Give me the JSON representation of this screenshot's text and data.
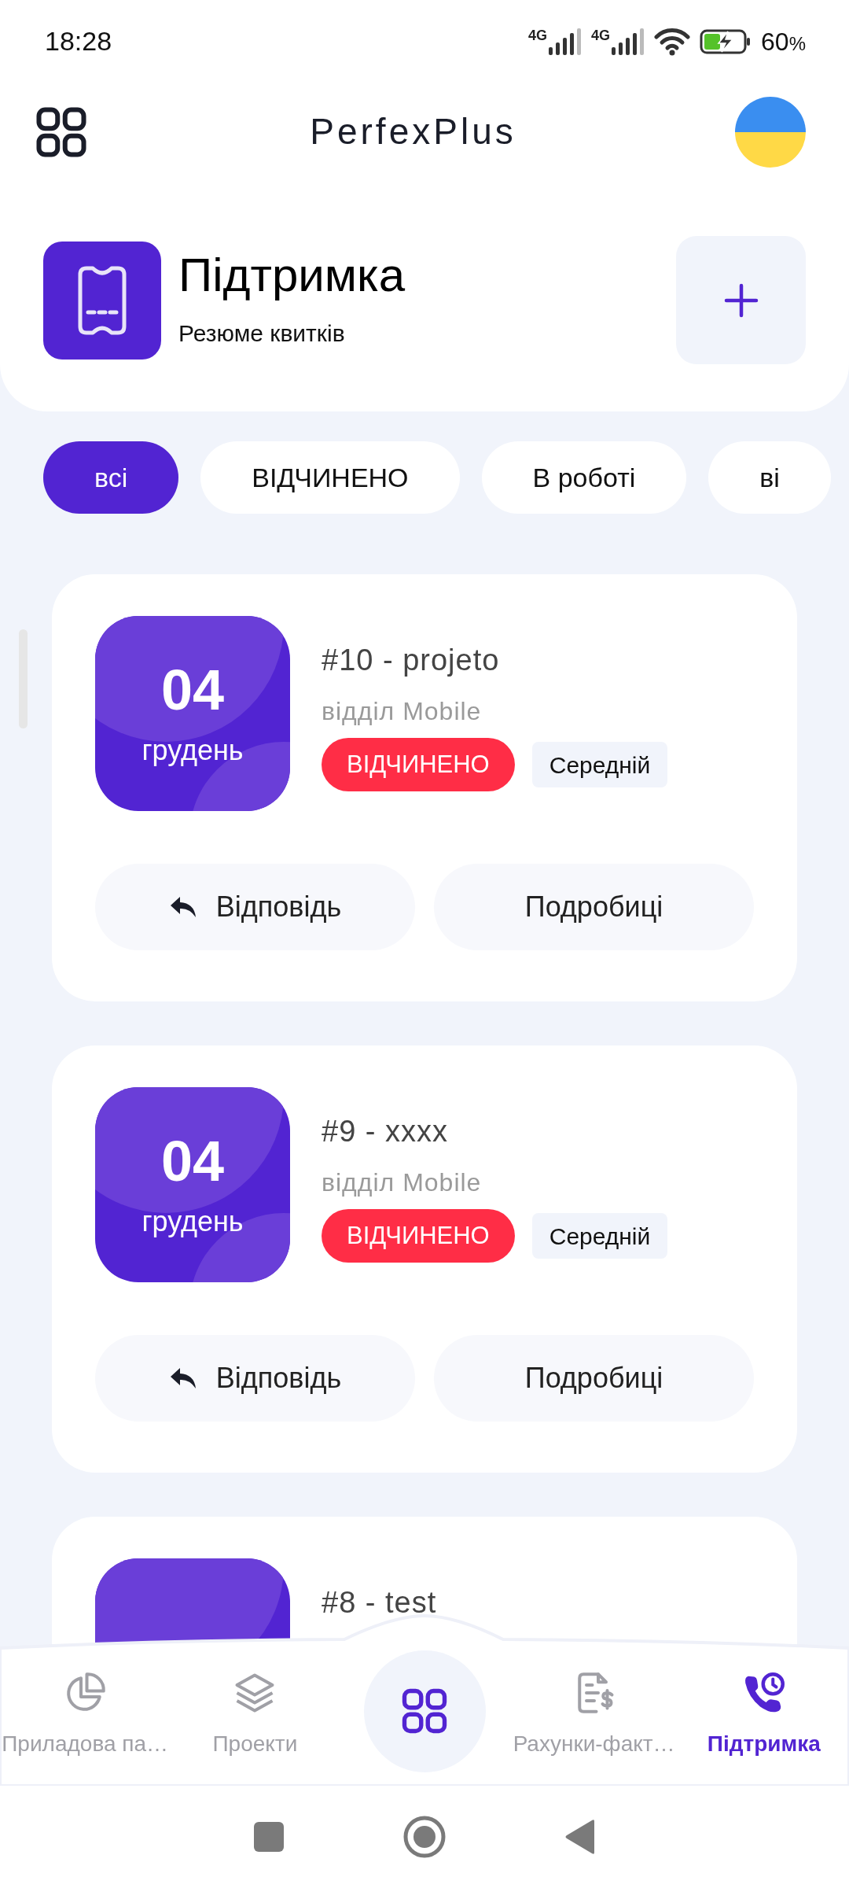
{
  "status_bar": {
    "time": "18:28",
    "networks": [
      "4G",
      "4G"
    ],
    "battery": "60",
    "battery_unit": "%"
  },
  "app_bar": {
    "title": "PerfexPlus"
  },
  "header": {
    "title": "Підтримка",
    "subtitle": "Резюме квитків"
  },
  "filters": [
    {
      "label": "всі",
      "selected": true
    },
    {
      "label": "ВІДЧИНЕНО",
      "selected": false
    },
    {
      "label": "В роботі",
      "selected": false
    },
    {
      "label": "ві",
      "selected": false
    }
  ],
  "tickets": [
    {
      "day": "04",
      "month": "грудень",
      "title": "#10 - projeto",
      "department": "відділ Mobile",
      "status": "ВІДЧИНЕНО",
      "color": "#ff2d46",
      "priority": "Середній",
      "actions": [
        {
          "kind": "reply",
          "label": "Відповідь"
        },
        {
          "kind": "details",
          "label": "Подробиці"
        }
      ]
    },
    {
      "day": "04",
      "month": "грудень",
      "title": "#9 - xxxx",
      "department": "відділ Mobile",
      "status": "ВІДЧИНЕНО",
      "color": "#ff2d46",
      "priority": "Середній",
      "actions": [
        {
          "kind": "reply",
          "label": "Відповідь"
        },
        {
          "kind": "details",
          "label": "Подробиці"
        }
      ]
    },
    {
      "title": "#8 - test"
    }
  ],
  "bottom_nav": [
    {
      "kind": "tab",
      "label": "Приладова па…",
      "selected": false
    },
    {
      "kind": "tab",
      "label": "Проекти",
      "selected": false
    },
    {
      "kind": "center"
    },
    {
      "kind": "tab",
      "label": "Рахунки-факт…",
      "selected": false
    },
    {
      "kind": "tab",
      "label": "Підтримка",
      "selected": true
    }
  ]
}
